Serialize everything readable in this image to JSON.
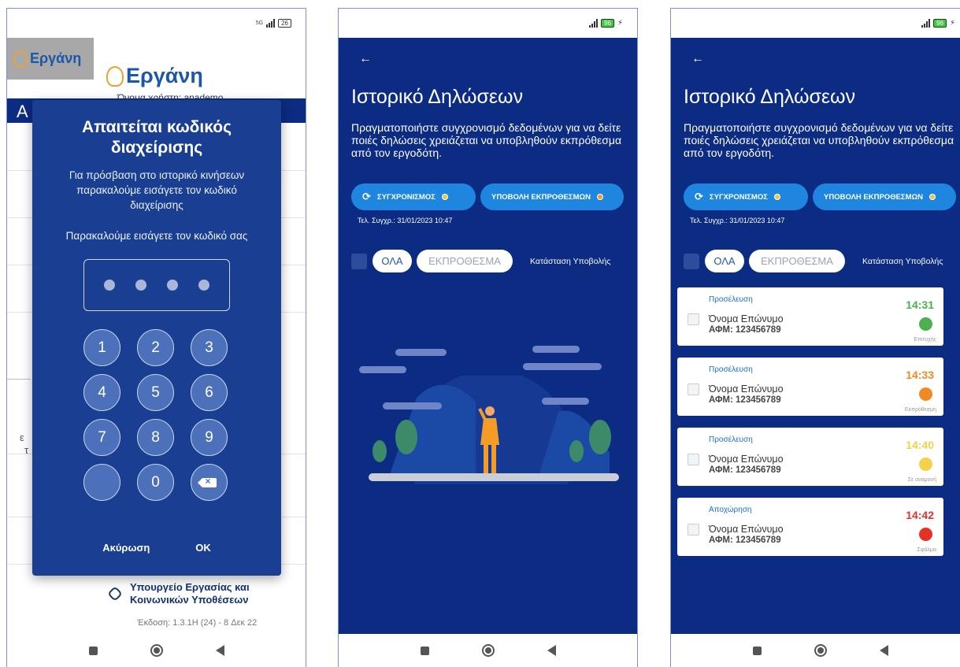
{
  "brand": {
    "name": "Εργάνη",
    "accent": "#1d58a8",
    "gold": "#e7a23a",
    "navy": "#0c2b82"
  },
  "phone1": {
    "status": {
      "network": "5G",
      "battery": "26"
    },
    "header_fragment": "Α",
    "user_line": "Όνομα χρήστη: anademo",
    "side_fragment_1": "ε",
    "side_fragment_2": "τ",
    "dialog": {
      "title": "Απαιτείται κωδικός διαχείρισης",
      "description": "Για πρόσβαση στο ιστορικό κινήσεων παρακαλούμε εισάγετε τον κωδικό διαχείρισης",
      "prompt": "Παρακαλούμε εισάγετε τον κωδικό σας",
      "keys": [
        "1",
        "2",
        "3",
        "4",
        "5",
        "6",
        "7",
        "8",
        "9",
        "",
        "0"
      ],
      "cancel_label": "Ακύρωση",
      "ok_label": "OK"
    },
    "ministry": "Υπουργείο Εργασίας και Κοινωνικών Υποθέσεων",
    "version": "Έκδοση: 1.3.1H (24) - 8 Δεκ 22"
  },
  "history": {
    "battery": "96",
    "title": "Ιστορικό Δηλώσεων",
    "description": "Πραγματοποιήστε συγχρονισμό δεδομένων για να δείτε ποιές δηλώσεις χρειάζεται να υποβληθούν εκπρόθεσμα από τον εργοδότη.",
    "sync_label": "ΣΥΓΧΡΟΝΙΣΜΟΣ",
    "submit_late_label": "ΥΠΟΒΟΛΗ ΕΚΠΡΟΘΕΣΜΩΝ",
    "last_sync": "Τελ. Συγχρ.: 31/01/2023 10:47",
    "filter_all": "ΟΛΑ",
    "filter_late": "ΕΚΠΡΟΘΕΣΜΑ",
    "status_filter_label": "Κατάσταση Υποβολής"
  },
  "records": [
    {
      "type": "Προσέλευση",
      "name": "Όνομα Επώνυμο",
      "afm": "ΑΦΜ: 123456789",
      "time": "14:31",
      "status": "Επιτυχής",
      "color": "#4caf50"
    },
    {
      "type": "Προσέλευση",
      "name": "Όνομα Επώνυμο",
      "afm": "ΑΦΜ: 123456789",
      "time": "14:33",
      "status": "Εκπρόθεσμη",
      "color": "#f08a24"
    },
    {
      "type": "Προσέλευση",
      "name": "Όνομα Επώνυμο",
      "afm": "ΑΦΜ: 123456789",
      "time": "14:40",
      "status": "Σε αναμονή",
      "color": "#f5d04a"
    },
    {
      "type": "Αποχώρηση",
      "name": "Όνομα Επώνυμο",
      "afm": "ΑΦΜ: 123456789",
      "time": "14:42",
      "status": "Σφάλμα",
      "color": "#e53227"
    }
  ]
}
